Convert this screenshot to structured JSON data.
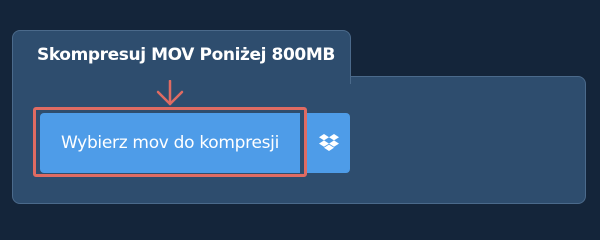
{
  "header": {
    "title": "Skompresuj MOV Poniżej 800MB"
  },
  "upload": {
    "button_label": "Wybierz mov do kompresji",
    "dropbox_icon": "dropbox-icon"
  },
  "colors": {
    "background": "#14253a",
    "panel": "#2e4d6e",
    "button": "#4e9ce8",
    "highlight": "#e06b62"
  }
}
